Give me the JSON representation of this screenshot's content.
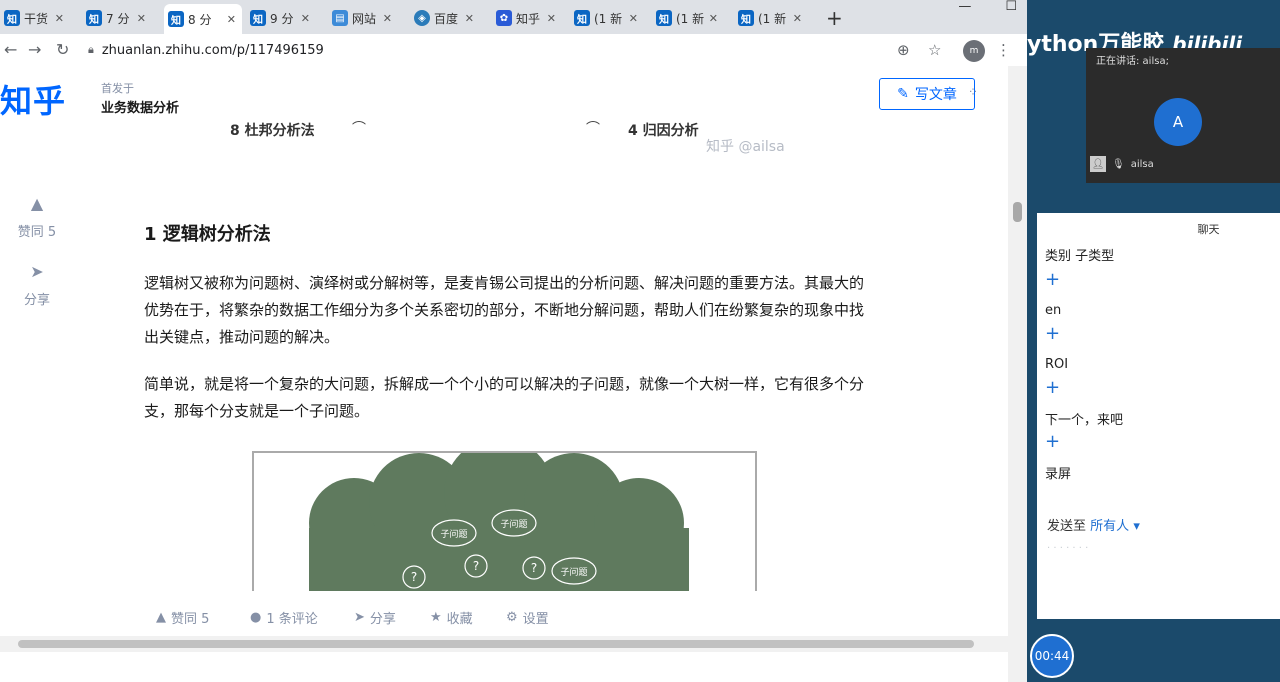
{
  "tabs": [
    {
      "icon": "zhihu-icon",
      "fav": "知",
      "label": "干货"
    },
    {
      "icon": "zhihu-icon",
      "fav": "知",
      "label": "7 分"
    },
    {
      "icon": "zhihu-icon",
      "fav": "知",
      "label": "8 分"
    },
    {
      "icon": "zhihu-icon",
      "fav": "知",
      "label": "9 分"
    },
    {
      "icon": "chart-icon",
      "fav": "▤",
      "label": "网站"
    },
    {
      "icon": "cloud-icon",
      "fav": "◈",
      "label": "百度"
    },
    {
      "icon": "paw-icon",
      "fav": "✿",
      "label": "知乎"
    },
    {
      "icon": "zhihu-icon",
      "fav": "知",
      "label": "(1 新"
    },
    {
      "icon": "zhihu-icon",
      "fav": "知",
      "label": "(1 新"
    },
    {
      "icon": "zhihu-icon",
      "fav": "知",
      "label": "(1 新"
    }
  ],
  "address_bar": {
    "url": "zhuanlan.zhihu.com/p/117496159"
  },
  "profile_initials": "m",
  "header": {
    "logo": "知乎",
    "published_in": "首发于",
    "column_name": "业务数据分析",
    "write_button": "写文章"
  },
  "diagram_snippet": {
    "left_label": "8 杜邦分析法",
    "right_label": "4 归因分析",
    "watermark": "知乎 @ailsa"
  },
  "side_actions": {
    "vote": "赞同 5",
    "share": "分享"
  },
  "article": {
    "heading": "1 逻辑树分析法",
    "para1": "逻辑树又被称为问题树、演绎树或分解树等，是麦肯锡公司提出的分析问题、解决问题的重要方法。其最大的优势在于，将繁杂的数据工作细分为多个关系密切的部分，不断地分解问题，帮助人们在纷繁复杂的现象中找出关键点，推动问题的解决。",
    "para2": "简单说，就是将一个复杂的大问题，拆解成一个个小的可以解决的子问题，就像一个大树一样，它有很多个分支，那每个分支就是一个子问题。",
    "figure_labels": [
      "子问题",
      "子问题",
      "子问题"
    ]
  },
  "bottom_bar": {
    "vote": "赞同 5",
    "comments": "1 条评论",
    "share": "分享",
    "favorite": "收藏",
    "settings": "设置"
  },
  "overlay": {
    "banner": "ython万能胶",
    "bilibili": "bilibili",
    "speaking": "正在讲话: ailsa;",
    "avatar_letter": "A",
    "attendee_name": "ailsa",
    "timer": "00:44"
  },
  "chat": {
    "title": "聊天",
    "messages": [
      "类别 子类型",
      "en",
      "ROI",
      "下一个，来吧",
      "录屏"
    ],
    "send_to_label": "发送至",
    "send_to_target": "所有人"
  }
}
